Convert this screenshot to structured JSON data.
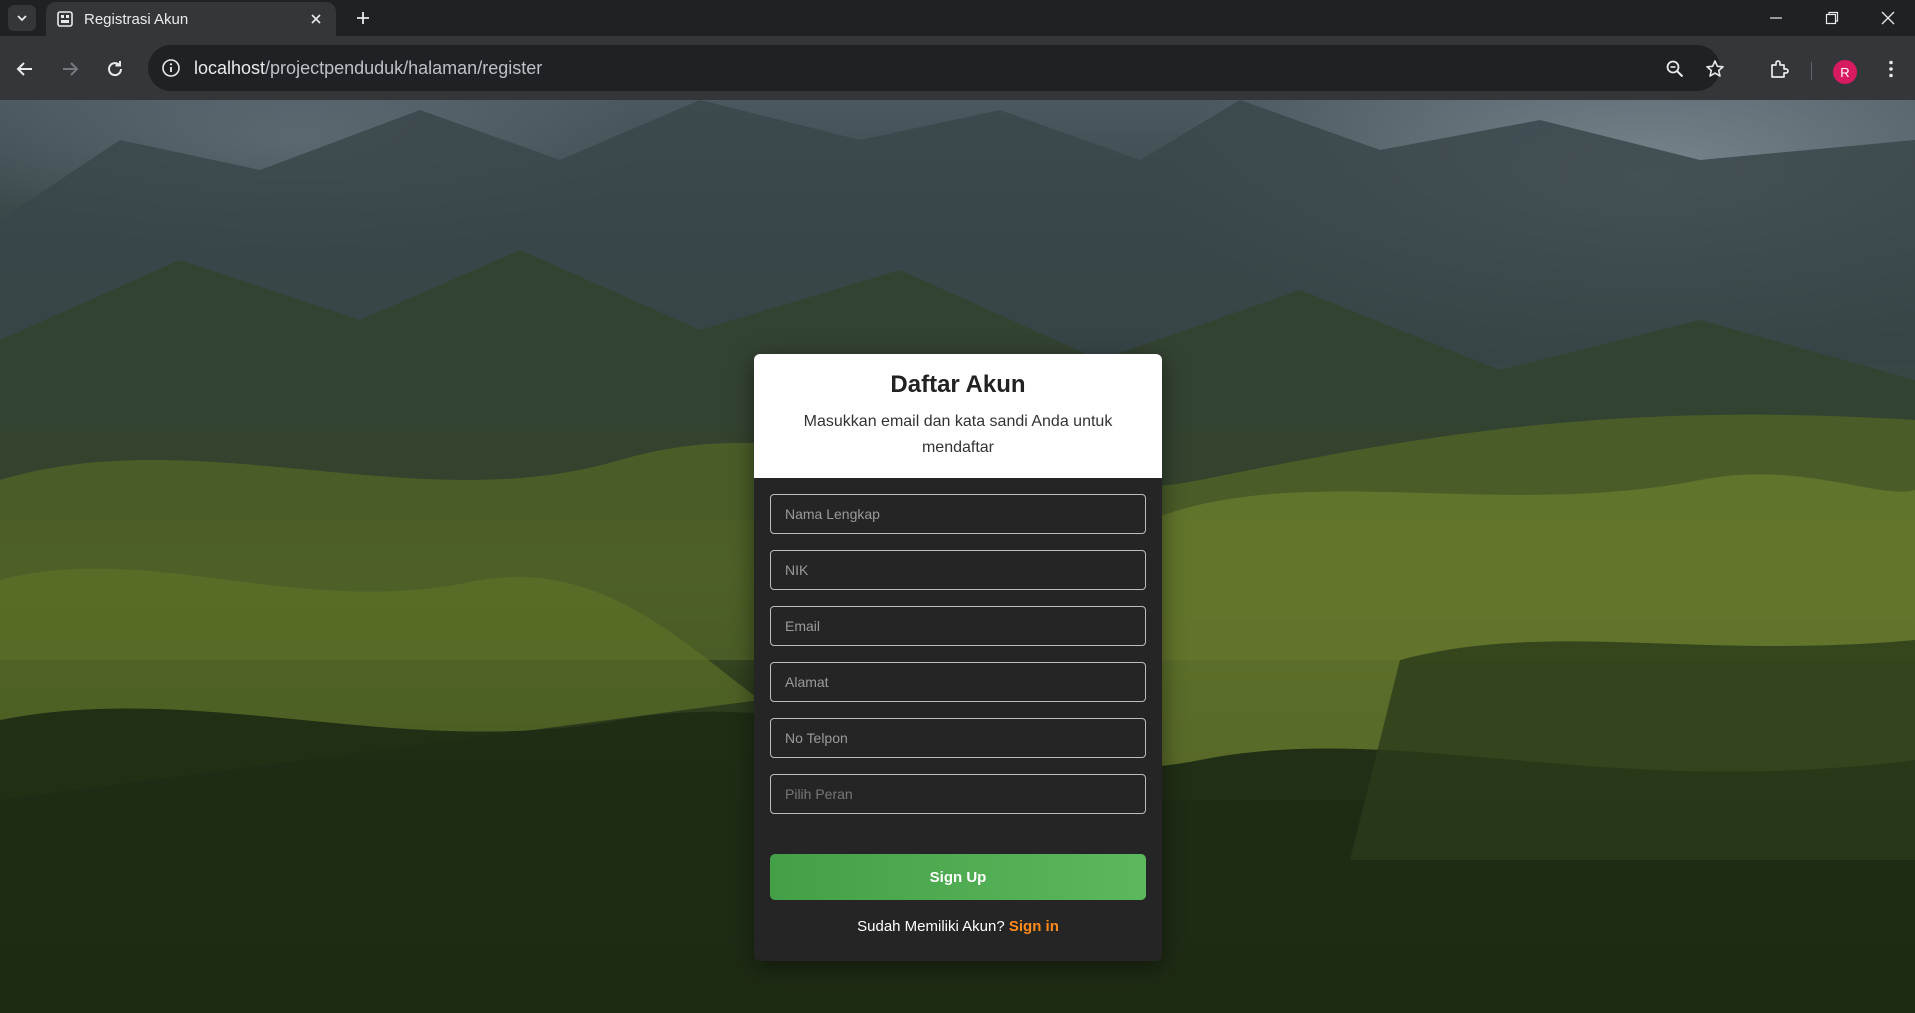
{
  "browser": {
    "tab_title": "Registrasi Akun",
    "url_host": "localhost",
    "url_path": "/projectpenduduk/halaman/register",
    "profile_initial": "R"
  },
  "form": {
    "title": "Daftar Akun",
    "subtitle": "Masukkan email dan kata sandi Anda untuk mendaftar",
    "fields": {
      "full_name_placeholder": "Nama Lengkap",
      "nik_placeholder": "NIK",
      "email_placeholder": "Email",
      "address_placeholder": "Alamat",
      "phone_placeholder": "No Telpon",
      "role_placeholder": "Pilih Peran"
    },
    "signup_label": "Sign Up",
    "signin_prompt": "Sudah Memiliki Akun?",
    "signin_link": "Sign in"
  },
  "colors": {
    "signup_button": "#4caf50",
    "signin_link": "#ff8c1a",
    "avatar": "#d81b60"
  },
  "icons": [
    "tab-list-icon",
    "page-favicon-icon",
    "close-icon",
    "plus-icon",
    "minimize-icon",
    "restore-icon",
    "window-close-icon",
    "back-arrow-icon",
    "forward-arrow-icon",
    "reload-icon",
    "info-icon",
    "zoom-icon",
    "star-icon",
    "extensions-icon",
    "kebab-menu-icon"
  ]
}
